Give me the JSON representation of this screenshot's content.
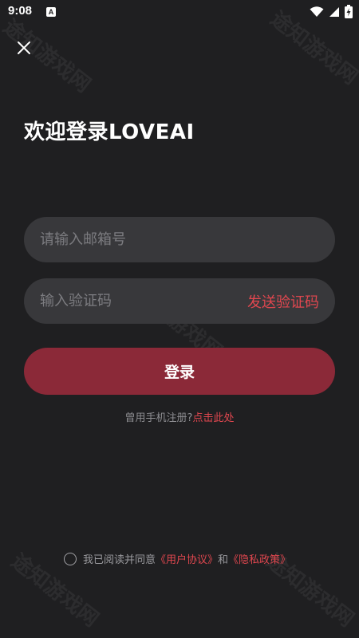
{
  "status_bar": {
    "time": "9:08",
    "badge": "A"
  },
  "header": {
    "title": "欢迎登录LOVEAI"
  },
  "form": {
    "email_placeholder": "请输入邮箱号",
    "code_placeholder": "输入验证码",
    "send_code_label": "发送验证码",
    "login_label": "登录"
  },
  "register": {
    "prompt": "曾用手机注册?",
    "link_label": "点击此处"
  },
  "agreement": {
    "text_prefix": "我已阅读并同意",
    "user_agreement": "《用户协议》",
    "conjunction": "和",
    "privacy_policy": "《隐私政策》"
  },
  "watermark": {
    "text": "途知游戏网"
  },
  "colors": {
    "background": "#1f1f21",
    "input_background": "#38383b",
    "accent": "#e0474f",
    "button": "#8b2938"
  },
  "icons": {
    "close": "close-icon",
    "wifi": "wifi-icon",
    "signal": "signal-icon",
    "battery": "battery-charging-icon"
  }
}
